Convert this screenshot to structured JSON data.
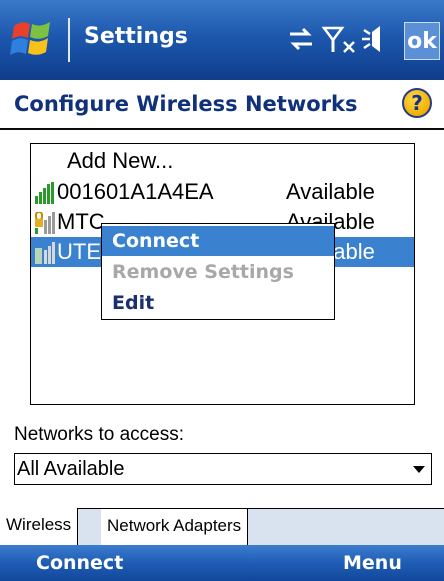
{
  "title_bar": {
    "title": "Settings",
    "ok_label": "ok",
    "status_icons": [
      "connectivity-icon",
      "signal-off-icon",
      "speaker-icon"
    ]
  },
  "header": {
    "title": "Configure Wireless Networks",
    "help_label": "?"
  },
  "networks": {
    "add_new": "Add New...",
    "items": [
      {
        "name": "001601A1A4EA",
        "status": "Available",
        "selected": false
      },
      {
        "name": "MTC",
        "status": "Available",
        "selected": false
      },
      {
        "name": "UTE",
        "status": "Available",
        "selected": true
      }
    ]
  },
  "context_menu": {
    "items": [
      {
        "label": "Connect",
        "state": "active"
      },
      {
        "label": "Remove Settings",
        "state": "disabled"
      },
      {
        "label": "Edit",
        "state": "normal"
      }
    ]
  },
  "access": {
    "label": "Networks to access:",
    "selected": "All Available"
  },
  "tabs": [
    {
      "label": "Wireless",
      "active": true
    },
    {
      "label": "Network Adapters",
      "active": false
    }
  ],
  "softkeys": {
    "left": "Connect",
    "right": "Menu"
  },
  "colors": {
    "title_bar": "#1d58ad",
    "selection": "#3a82cf",
    "header_text": "#10317c"
  }
}
